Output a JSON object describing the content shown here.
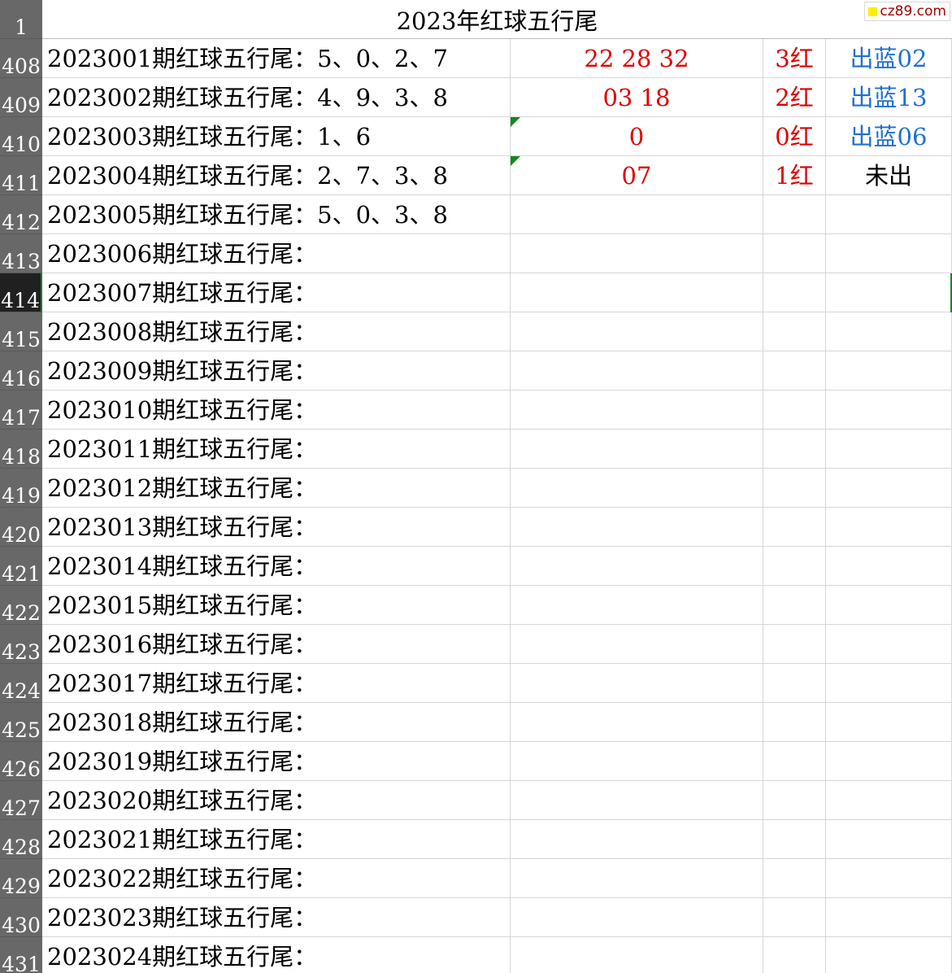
{
  "sheet": {
    "title_row_num": "1",
    "title": "2023年红球五行尾",
    "watermark": "cz89.com",
    "rows": [
      {
        "num": "408",
        "period": "2023001期红球五行尾：5、0、2、7",
        "balls": "22 28 32",
        "count": "3红",
        "blue": "出蓝02",
        "blue_color": "blue"
      },
      {
        "num": "409",
        "period": "2023002期红球五行尾：4、9、3、8",
        "balls": "03 18",
        "count": "2红",
        "blue": "出蓝13",
        "blue_color": "blue"
      },
      {
        "num": "410",
        "period": "2023003期红球五行尾：1、6",
        "balls": "0",
        "count": "0红",
        "blue": "出蓝06",
        "blue_color": "blue",
        "marker": true
      },
      {
        "num": "411",
        "period": "2023004期红球五行尾：2、7、3、8",
        "balls": "07",
        "count": "1红",
        "blue": "未出",
        "blue_color": "black",
        "marker": true
      },
      {
        "num": "412",
        "period": "2023005期红球五行尾：5、0、3、8",
        "balls": "",
        "count": "",
        "blue": ""
      },
      {
        "num": "413",
        "period": "2023006期红球五行尾：",
        "balls": "",
        "count": "",
        "blue": ""
      },
      {
        "num": "414",
        "period": "2023007期红球五行尾：",
        "balls": "",
        "count": "",
        "blue": "",
        "active": true
      },
      {
        "num": "415",
        "period": "2023008期红球五行尾：",
        "balls": "",
        "count": "",
        "blue": ""
      },
      {
        "num": "416",
        "period": "2023009期红球五行尾：",
        "balls": "",
        "count": "",
        "blue": ""
      },
      {
        "num": "417",
        "period": "2023010期红球五行尾：",
        "balls": "",
        "count": "",
        "blue": ""
      },
      {
        "num": "418",
        "period": "2023011期红球五行尾：",
        "balls": "",
        "count": "",
        "blue": ""
      },
      {
        "num": "419",
        "period": "2023012期红球五行尾：",
        "balls": "",
        "count": "",
        "blue": ""
      },
      {
        "num": "420",
        "period": "2023013期红球五行尾：",
        "balls": "",
        "count": "",
        "blue": ""
      },
      {
        "num": "421",
        "period": "2023014期红球五行尾：",
        "balls": "",
        "count": "",
        "blue": ""
      },
      {
        "num": "422",
        "period": "2023015期红球五行尾：",
        "balls": "",
        "count": "",
        "blue": ""
      },
      {
        "num": "423",
        "period": "2023016期红球五行尾：",
        "balls": "",
        "count": "",
        "blue": ""
      },
      {
        "num": "424",
        "period": "2023017期红球五行尾：",
        "balls": "",
        "count": "",
        "blue": ""
      },
      {
        "num": "425",
        "period": "2023018期红球五行尾：",
        "balls": "",
        "count": "",
        "blue": ""
      },
      {
        "num": "426",
        "period": "2023019期红球五行尾：",
        "balls": "",
        "count": "",
        "blue": ""
      },
      {
        "num": "427",
        "period": "2023020期红球五行尾：",
        "balls": "",
        "count": "",
        "blue": ""
      },
      {
        "num": "428",
        "period": "2023021期红球五行尾：",
        "balls": "",
        "count": "",
        "blue": ""
      },
      {
        "num": "429",
        "period": "2023022期红球五行尾：",
        "balls": "",
        "count": "",
        "blue": ""
      },
      {
        "num": "430",
        "period": "2023023期红球五行尾：",
        "balls": "",
        "count": "",
        "blue": ""
      },
      {
        "num": "431",
        "period": "2023024期红球五行尾：",
        "balls": "",
        "count": "",
        "blue": ""
      }
    ]
  }
}
